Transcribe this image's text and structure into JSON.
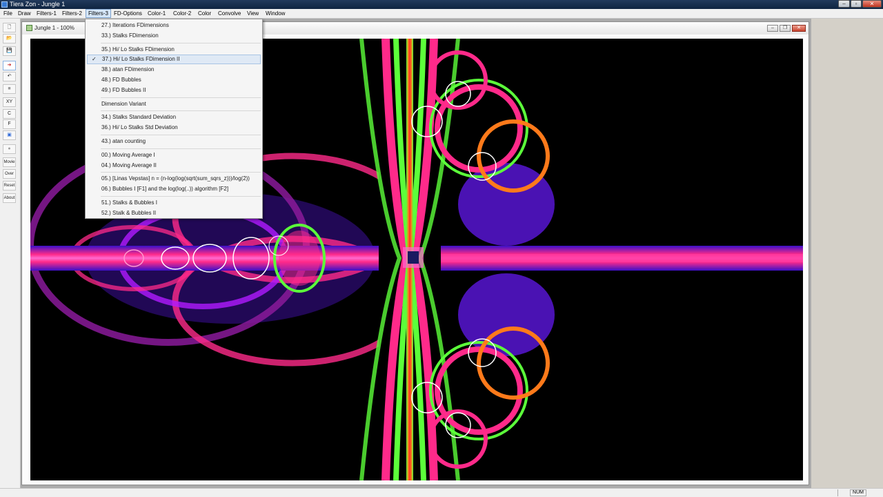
{
  "window": {
    "title": "Tiera Zon - Jungle 1"
  },
  "menubar": [
    {
      "label": "File"
    },
    {
      "label": "Draw"
    },
    {
      "label": "Filters-1"
    },
    {
      "label": "Filters-2"
    },
    {
      "label": "Filters-3",
      "active": true
    },
    {
      "label": "FD-Options"
    },
    {
      "label": "Color-1"
    },
    {
      "label": "Color-2"
    },
    {
      "label": "Color"
    },
    {
      "label": "Convolve"
    },
    {
      "label": "View"
    },
    {
      "label": "Window"
    }
  ],
  "toolbar": {
    "buttons": [
      {
        "icon": "new-document-icon",
        "glyph": "🗋"
      },
      {
        "icon": "open-folder-icon",
        "glyph": "📂"
      },
      {
        "icon": "save-icon",
        "glyph": "💾"
      },
      {
        "icon": "draw-arrow-icon",
        "glyph": "➔"
      },
      {
        "icon": "undo-icon",
        "glyph": "↶"
      },
      {
        "icon": "stop-icon",
        "glyph": "■"
      },
      {
        "label": "XY"
      },
      {
        "label": "C"
      },
      {
        "label": "F"
      },
      {
        "icon": "window-icon",
        "glyph": "▣"
      },
      {
        "icon": "circle-icon",
        "glyph": "●"
      },
      {
        "label": "Movie"
      },
      {
        "label": "Over"
      },
      {
        "label": "Reset"
      },
      {
        "label": "About"
      }
    ]
  },
  "child_window": {
    "title": "Jungle 1 - 100%"
  },
  "dropdown": {
    "items": [
      {
        "label": "27.) Iterations FDimensions"
      },
      {
        "label": "33.) Stalks FDimension"
      },
      {
        "separator": true
      },
      {
        "label": "35.) Hi/ Lo Stalks FDimension"
      },
      {
        "label": "37.) Hi/ Lo Stalks FDimension II",
        "checked": true,
        "highlighted": true
      },
      {
        "label": "38.) atan FDimension"
      },
      {
        "label": "48.) FD Bubbles"
      },
      {
        "label": "49.) FD Bubbles II"
      },
      {
        "separator": true
      },
      {
        "label": "Dimension Variant"
      },
      {
        "separator": true
      },
      {
        "label": "34.) Stalks Standard Deviation"
      },
      {
        "label": "36.) Hi/ Lo Stalks Std Deviation"
      },
      {
        "separator": true
      },
      {
        "label": "43.) atan counting"
      },
      {
        "separator": true
      },
      {
        "label": "00.) Moving Average I"
      },
      {
        "label": "04.) Moving Average II"
      },
      {
        "separator": true
      },
      {
        "label": "05.) [Linas Vepstas] n = (n-log(log(sqrt(sum_sqrs_z)))/log(2))"
      },
      {
        "label": "06.) Bubbles I [F1] and the log(log(..)) algorithm [F2]"
      },
      {
        "separator": true
      },
      {
        "label": "51.) Stalks & Bubbles I"
      },
      {
        "label": "52.) Stalk & Bubbles II"
      }
    ],
    "check_glyph": "✓"
  },
  "statusbar": {
    "num": "NUM"
  },
  "colors": {
    "fractal_magenta": "#ff2a8a",
    "fractal_purple": "#6a1aff",
    "fractal_green": "#5cff3a",
    "fractal_orange": "#ff7a1a",
    "canvas_bg": "#000000"
  }
}
